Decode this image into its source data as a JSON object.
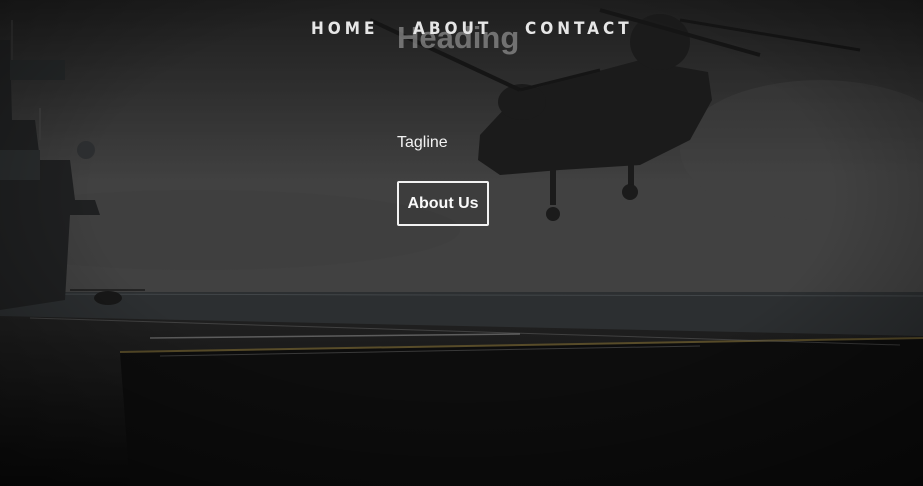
{
  "nav": {
    "items": [
      {
        "label": "HOME"
      },
      {
        "label": "ABOUT"
      },
      {
        "label": "CONTACT"
      }
    ]
  },
  "hero": {
    "heading": "Heading",
    "tagline": "Tagline",
    "button_label": "About Us",
    "background_subject": "helicopter over ship deck at sea"
  },
  "colors": {
    "overlay": "#000000",
    "text": "#f2f2f2",
    "heading": "#969696"
  }
}
